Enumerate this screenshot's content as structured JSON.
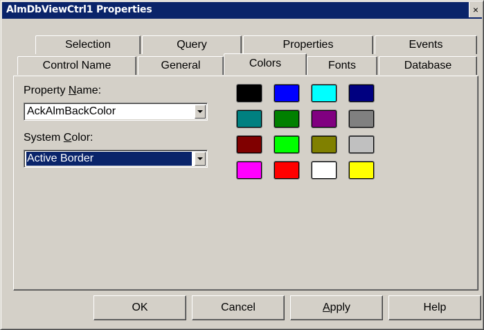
{
  "window": {
    "title": "AlmDbViewCtrl1 Properties",
    "close_glyph": "×"
  },
  "tabs": {
    "row1": [
      "Selection",
      "Query",
      "Properties",
      "Events"
    ],
    "row2": [
      "Control Name",
      "General",
      "Colors",
      "Fonts",
      "Database"
    ],
    "active": "Colors"
  },
  "property_name": {
    "label_pre": "Property ",
    "label_u": "N",
    "label_post": "ame:",
    "value": "AckAlmBackColor"
  },
  "system_color": {
    "label_pre": "System ",
    "label_u": "C",
    "label_post": "olor:",
    "value": "Active Border"
  },
  "palette": [
    "#000000",
    "#0000ff",
    "#00ffff",
    "#000080",
    "#008080",
    "#008000",
    "#800080",
    "#808080",
    "#800000",
    "#00ff00",
    "#808000",
    "#c0c0c0",
    "#ff00ff",
    "#ff0000",
    "#ffffff",
    "#ffff00"
  ],
  "buttons": {
    "ok": "OK",
    "cancel": "Cancel",
    "apply_u": "A",
    "apply_rest": "pply",
    "help": "Help"
  },
  "colors": {
    "face": "#d4d0c8",
    "titlebar": "#0a246a",
    "selection": "#0a246a"
  }
}
